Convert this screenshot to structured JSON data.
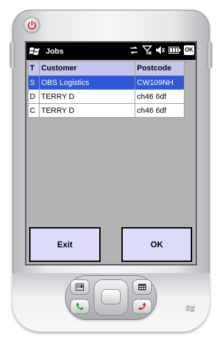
{
  "window": {
    "title": "Jobs",
    "ok_label": "OK"
  },
  "grid": {
    "headers": [
      "T",
      "Customer",
      "Postcode"
    ],
    "rows": [
      {
        "t": "S",
        "customer": "OBS Logistics",
        "postcode": "CW109NH",
        "selected": true
      },
      {
        "t": "D",
        "customer": "TERRY D",
        "postcode": "ch46 6df",
        "selected": false
      },
      {
        "t": "C",
        "customer": "TERRY D",
        "postcode": "ch46 6df",
        "selected": false
      }
    ]
  },
  "buttons": {
    "exit": "Exit",
    "ok": "OK"
  },
  "icons": [
    "power-icon",
    "start-flag-icon",
    "sync-icon",
    "signal-off-icon",
    "volume-mute-icon",
    "battery-icon",
    "contacts-icon",
    "calendar-icon",
    "call-icon",
    "end-call-icon",
    "windows-logo-icon"
  ],
  "colors": {
    "selection": "#2f58d8",
    "header": "#c6c6ec",
    "button": "#dcdcf8",
    "screen_bg": "#b3b3b6"
  }
}
